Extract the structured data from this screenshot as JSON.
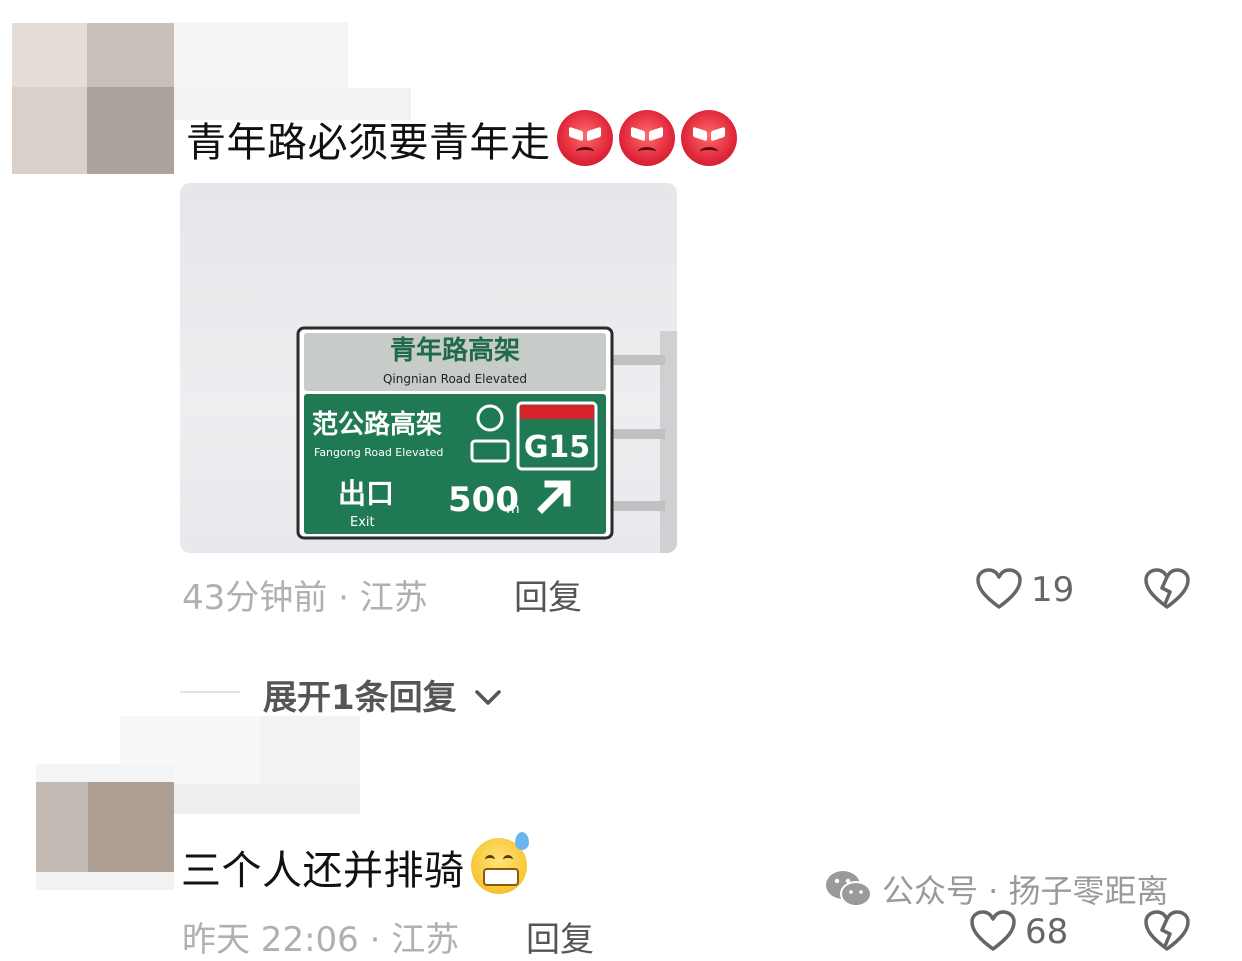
{
  "comments": [
    {
      "text": "青年路必须要青年走",
      "emojis": [
        "angry-face-icon",
        "angry-face-icon",
        "angry-face-icon"
      ],
      "time": "43分钟前",
      "location": "江苏",
      "meta_separator": " · ",
      "reply_label": "回复",
      "like_count": "19",
      "sign": {
        "title_cn": "青年路高架",
        "title_en": "Qingnian Road Elevated",
        "sub_cn": "范公路高架",
        "sub_en": "Fangong Road Elevated",
        "route": "G15",
        "exit_cn": "出口",
        "exit_en": "Exit",
        "distance": "500",
        "distance_unit": "m"
      }
    },
    {
      "text": "三个人还并排骑",
      "emojis": [
        "grinning-sweat-icon"
      ],
      "time": "昨天 22:06",
      "location": "江苏",
      "meta_separator": " · ",
      "reply_label": "回复",
      "like_count": "68"
    }
  ],
  "expand_replies_label": "展开1条回复",
  "watermark": "公众号 · 扬子零距离",
  "colors": {
    "sign_green": "#1f7a54",
    "sign_header_gray": "#c8ccc9",
    "route_red": "#d7242c",
    "meta_gray": "#b0b0b0"
  }
}
